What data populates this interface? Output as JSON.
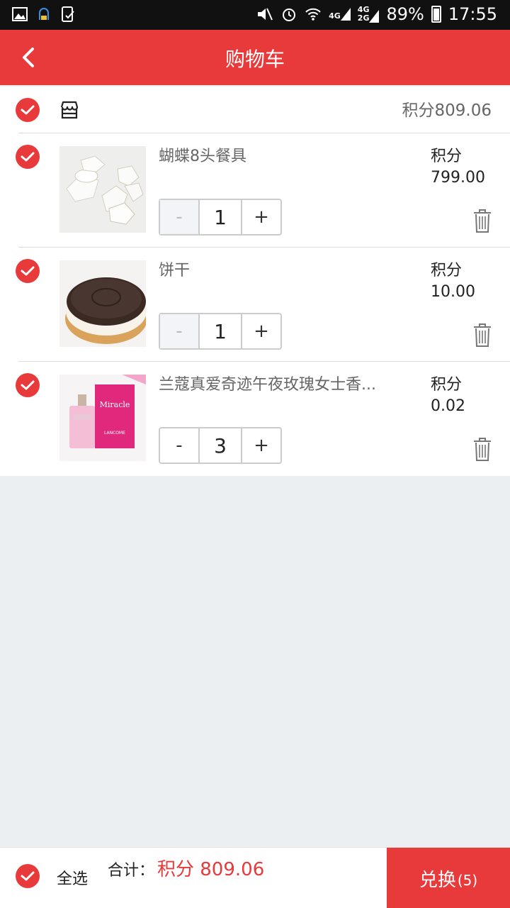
{
  "status_bar": {
    "network_4g": "4G",
    "network_4g_2g_top": "4G",
    "network_4g_2g_bottom": "2G",
    "battery": "89%",
    "time": "17:55"
  },
  "header": {
    "title": "购物车"
  },
  "shop": {
    "total": "积分809.06"
  },
  "items": [
    {
      "name": "蝴蝶8头餐具",
      "price_label": "积分",
      "price": "799.00",
      "quantity": "1",
      "minus": "-",
      "plus": "+"
    },
    {
      "name": "饼干",
      "price_label": "积分",
      "price": "10.00",
      "quantity": "1",
      "minus": "-",
      "plus": "+"
    },
    {
      "name": "兰蔻真爱奇迹午夜玫瑰女士香...",
      "price_label": "积分",
      "price": "0.02",
      "quantity": "3",
      "minus": "-",
      "plus": "+"
    }
  ],
  "perfume_box_text": "Miracle",
  "perfume_box_brand": "LANCOME",
  "footer": {
    "select_all": "全选",
    "total_label": "合计：",
    "total_value": "积分 809.06",
    "exchange_label": "兑换",
    "exchange_count": "(5)"
  },
  "colors": {
    "accent": "#e83a3a",
    "background": "#eceff2"
  }
}
